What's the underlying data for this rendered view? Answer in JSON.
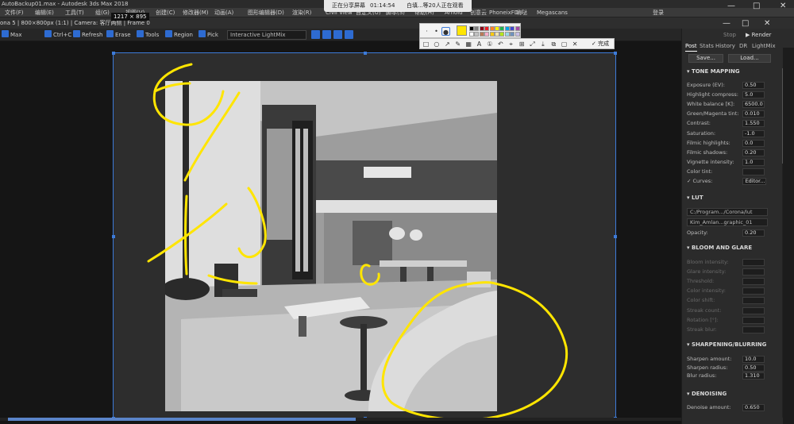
{
  "app": {
    "title": "AutoBackup01.max - Autodesk 3ds Max 2018",
    "menu": [
      "文件(F)",
      "编辑(E)",
      "工具(T)",
      "组(G)",
      "视图(V)",
      "创建(C)",
      "修改器(M)",
      "动画(A)",
      "图形编辑器(D)",
      "渲染(R)",
      "Civil View",
      "自定义(U)",
      "脚本(S)",
      "帮助(H)",
      "Arnold",
      "创意云",
      "PhoneixFD",
      "嗨哒",
      "Megascans"
    ],
    "login_label": "登录",
    "window_controls": [
      "—",
      "□",
      "✕"
    ]
  },
  "share": {
    "label": "正在分享屏幕",
    "time": "01:14:54",
    "viewers": "白填...等20人正在观看",
    "dims": "1217 × 895"
  },
  "vfb": {
    "title": "ona 5 | 800×800px (1:1) | Camera: 客厅两侧 | Frame 0",
    "toolbar": [
      "Max",
      "Ctrl+C",
      "Refresh",
      "Erase",
      "Tools",
      "Region",
      "Pick"
    ],
    "lightmix": "Interactive LightMix",
    "window_controls": [
      "—",
      "□",
      "✕"
    ]
  },
  "annotation": {
    "active_color": "#ffe500",
    "palette": [
      "#000000",
      "#7f7f7f",
      "#880015",
      "#ed1c24",
      "#ff7f27",
      "#fff200",
      "#22b14c",
      "#00a2e8",
      "#3f48cc",
      "#a349a4",
      "#ffffff",
      "#c3c3c3",
      "#b97a57",
      "#ffaec9",
      "#ffc90e",
      "#efe4b0",
      "#b5e61d",
      "#99d9ea",
      "#7092be",
      "#c8bfe7"
    ],
    "tools": [
      "rect-icon",
      "ellipse-icon",
      "arrow-icon",
      "pen-icon",
      "mosaic-icon",
      "text-icon",
      "number-icon",
      "undo-icon",
      "pin-icon",
      "ocr-icon",
      "share-icon",
      "save-icon",
      "copy-icon",
      "save-file-icon",
      "cancel-icon",
      "confirm-icon"
    ],
    "done": "完成"
  },
  "panel": {
    "render": "Render",
    "stop": "Stop",
    "tabs": [
      "Post",
      "Stats",
      "History",
      "DR",
      "LightMix"
    ],
    "save": "Save...",
    "load": "Load...",
    "tone_mapping": {
      "title": "TONE MAPPING",
      "rows": [
        {
          "label": "Exposure (EV):",
          "value": "0.50"
        },
        {
          "label": "Highlight compress:",
          "value": "5.0"
        },
        {
          "label": "White balance [K]:",
          "value": "6500.0"
        },
        {
          "label": "Green/Magenta tint:",
          "value": "0.010"
        },
        {
          "label": "Contrast:",
          "value": "1.550"
        },
        {
          "label": "Saturation:",
          "value": "-1.0"
        },
        {
          "label": "Filmic highlights:",
          "value": "0.0"
        },
        {
          "label": "Filmic shadows:",
          "value": "0.20"
        },
        {
          "label": "Vignette intensity:",
          "value": "1.0"
        },
        {
          "label": "Color tint:",
          "value": ""
        }
      ],
      "curves": "Curves:",
      "editor": "Editor..."
    },
    "lut": {
      "title": "LUT",
      "path": "C:/Program.../Corona/lut",
      "file": "Kim_Amlan...graphic_01",
      "opacity_label": "Opacity:",
      "opacity": "0.20"
    },
    "bloom": {
      "title": "BLOOM AND GLARE",
      "rows": [
        "Bloom intensity:",
        "Glare intensity:",
        "Threshold:",
        "Color intensity:",
        "Color shift:",
        "Streak count:",
        "Rotation [°]:",
        "Streak blur:"
      ]
    },
    "sharpen": {
      "title": "SHARPENING/BLURRING",
      "rows": [
        {
          "label": "Sharpen amount:",
          "value": "10.0"
        },
        {
          "label": "Sharpen radius:",
          "value": "0.50"
        },
        {
          "label": "Blur radius:",
          "value": "1.310"
        }
      ]
    },
    "denoise": {
      "title": "DENOISING",
      "rows": [
        {
          "label": "Denoise amount:",
          "value": "0.650"
        }
      ]
    }
  }
}
